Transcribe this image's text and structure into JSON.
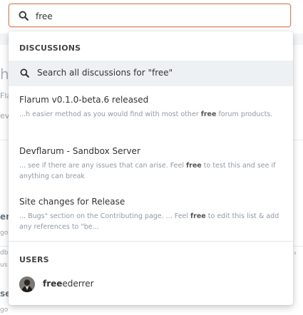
{
  "search": {
    "value": "free",
    "icon": "search-icon",
    "accent_color": "#d4845d"
  },
  "background": {
    "fragments": [
      "h",
      "Fla",
      "ev",
      "er",
      "go",
      "db",
      "us",
      "se",
      "go"
    ]
  },
  "dropdown": {
    "discussions_header": "DISCUSSIONS",
    "search_all_label": "Search all discussions for \"free\"",
    "results": [
      {
        "title": "Flarum v0.1.0-beta.6 released",
        "excerpt_pre": "...h easier method as you would find with most other ",
        "excerpt_highlight": "free",
        "excerpt_post": " forum products."
      },
      {
        "title": "Devflarum - Sandbox Server",
        "excerpt_pre": "... see if there are any issues that can arise. Feel ",
        "excerpt_highlight": "free",
        "excerpt_post": " to test this and see if anything can break"
      },
      {
        "title": "Site changes for Release",
        "excerpt_pre": "... Bugs\" section on the Contributing page. ... Feel ",
        "excerpt_highlight": "free",
        "excerpt_post": " to edit this list & add any references to \"be..."
      }
    ],
    "users_header": "USERS",
    "users": [
      {
        "name_highlight": "free",
        "name_rest": "ederrer"
      }
    ]
  }
}
